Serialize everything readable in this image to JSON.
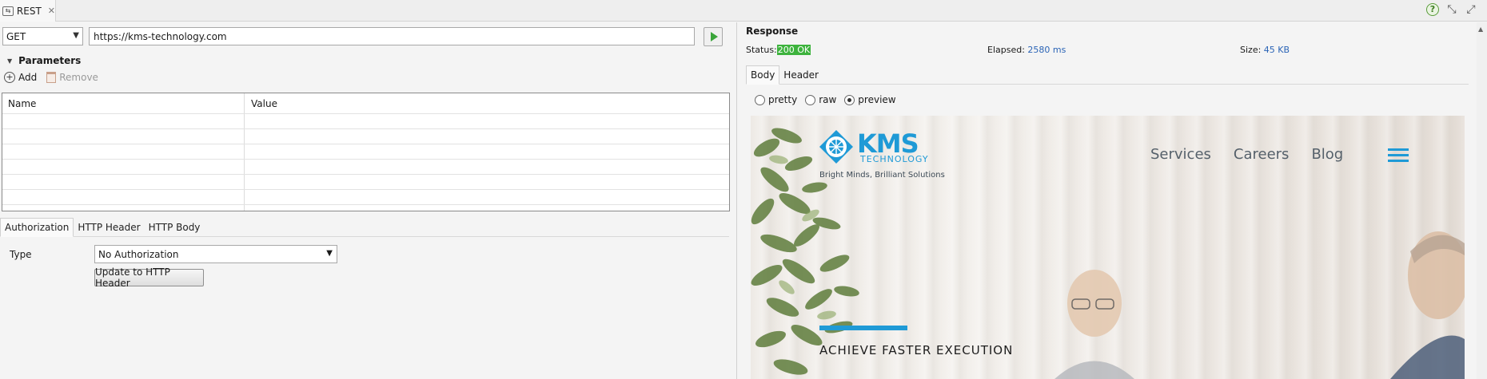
{
  "tab": {
    "label": "REST",
    "icon": "rest-icon",
    "close_icon": "close-icon"
  },
  "window_icons": [
    "help-icon",
    "minimize-icon",
    "maximize-icon"
  ],
  "request": {
    "method": "GET",
    "url": "https://kms-technology.com",
    "send_icon": "play-icon"
  },
  "parameters": {
    "title": "Parameters",
    "add_label": "Add",
    "remove_label": "Remove",
    "columns": [
      "Name",
      "Value"
    ],
    "rows": []
  },
  "request_tabs": [
    "Authorization",
    "HTTP Header",
    "HTTP Body"
  ],
  "auth": {
    "type_label": "Type",
    "type_value": "No Authorization",
    "update_button": "Update to HTTP Header"
  },
  "response": {
    "title": "Response",
    "status_label": "Status:",
    "status_value": "200 OK",
    "elapsed_label": "Elapsed:",
    "elapsed_value": "2580 ms",
    "size_label": "Size:",
    "size_value": "45 KB",
    "tabs": [
      "Body",
      "Header"
    ],
    "view_modes": [
      {
        "label": "pretty",
        "selected": false
      },
      {
        "label": "raw",
        "selected": false
      },
      {
        "label": "preview",
        "selected": true
      }
    ]
  },
  "preview_page": {
    "logo_text": "KMS",
    "logo_sub": "TECHNOLOGY",
    "tagline": "Bright Minds, Brilliant Solutions",
    "nav": [
      "Services",
      "Careers",
      "Blog"
    ],
    "headline": "ACHIEVE FASTER EXECUTION",
    "brand_color": "#1f9ad6"
  },
  "colors": {
    "status_ok": "#3db33d",
    "value_blue": "#2b64b6",
    "send_green": "#3aa53a"
  }
}
